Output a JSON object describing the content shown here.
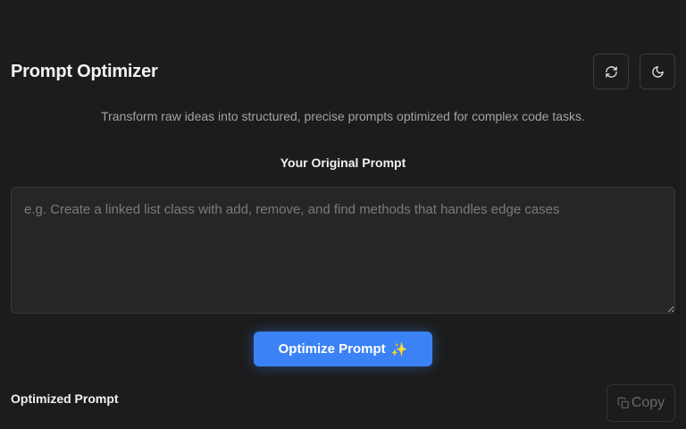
{
  "header": {
    "title": "Prompt Optimizer",
    "refresh_icon": "refresh-icon",
    "theme_icon": "moon-icon"
  },
  "subtitle": "Transform raw ideas into structured, precise prompts optimized for complex code tasks.",
  "input": {
    "label": "Your Original Prompt",
    "placeholder": "e.g. Create a linked list class with add, remove, and find methods that handles edge cases",
    "value": ""
  },
  "optimize_button": {
    "label": "Optimize Prompt",
    "icon": "✨"
  },
  "output": {
    "label": "Optimized Prompt",
    "copy_label": "Copy",
    "copy_icon": "copy-icon"
  },
  "colors": {
    "background": "#1c1c1c",
    "accent": "#3b82f6",
    "input_bg": "#262626"
  }
}
